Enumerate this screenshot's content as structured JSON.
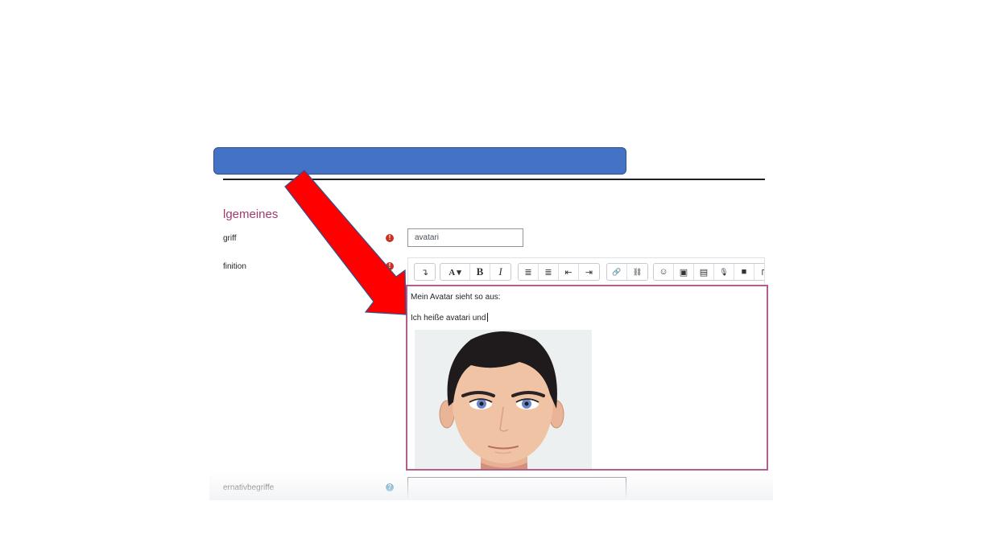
{
  "form": {
    "section_title": "lgemeines",
    "fields": {
      "begriff": {
        "label": "griff",
        "value": "avatari",
        "required_icon": "!"
      },
      "definition": {
        "label": "finition",
        "required_icon": "!"
      },
      "alternativbegriffe": {
        "label": "ernativbegriffe",
        "help_icon": "?"
      }
    }
  },
  "editor": {
    "line1": "Mein Avatar sieht so aus:",
    "line2": "Ich heiße avatari und",
    "image": "avatar-face"
  },
  "toolbar": {
    "buttons": [
      {
        "name": "collapse-toolbar-icon",
        "glyph": "↴"
      },
      {
        "name": "font-style-icon",
        "glyph": "A ▾"
      },
      {
        "name": "bold-icon",
        "glyph": "B"
      },
      {
        "name": "italic-icon",
        "glyph": "I"
      },
      {
        "name": "unordered-list-icon",
        "glyph": "≣"
      },
      {
        "name": "ordered-list-icon",
        "glyph": "≣"
      },
      {
        "name": "outdent-icon",
        "glyph": "⇤"
      },
      {
        "name": "indent-icon",
        "glyph": "⇥"
      },
      {
        "name": "link-icon",
        "glyph": "🔗"
      },
      {
        "name": "unlink-icon",
        "glyph": "⛓"
      },
      {
        "name": "emoji-icon",
        "glyph": "☺"
      },
      {
        "name": "image-icon",
        "glyph": "▣"
      },
      {
        "name": "media-icon",
        "glyph": "▤"
      },
      {
        "name": "microphone-icon",
        "glyph": "🎙"
      },
      {
        "name": "video-icon",
        "glyph": "■"
      },
      {
        "name": "more-icon",
        "glyph": "⊓"
      }
    ]
  },
  "colors": {
    "banner": "#4472c4",
    "arrow": "#ff0000",
    "accent": "#a23a6f",
    "editor_border": "#b65c8f",
    "required": "#ca3120",
    "help": "#1f7fa3"
  }
}
